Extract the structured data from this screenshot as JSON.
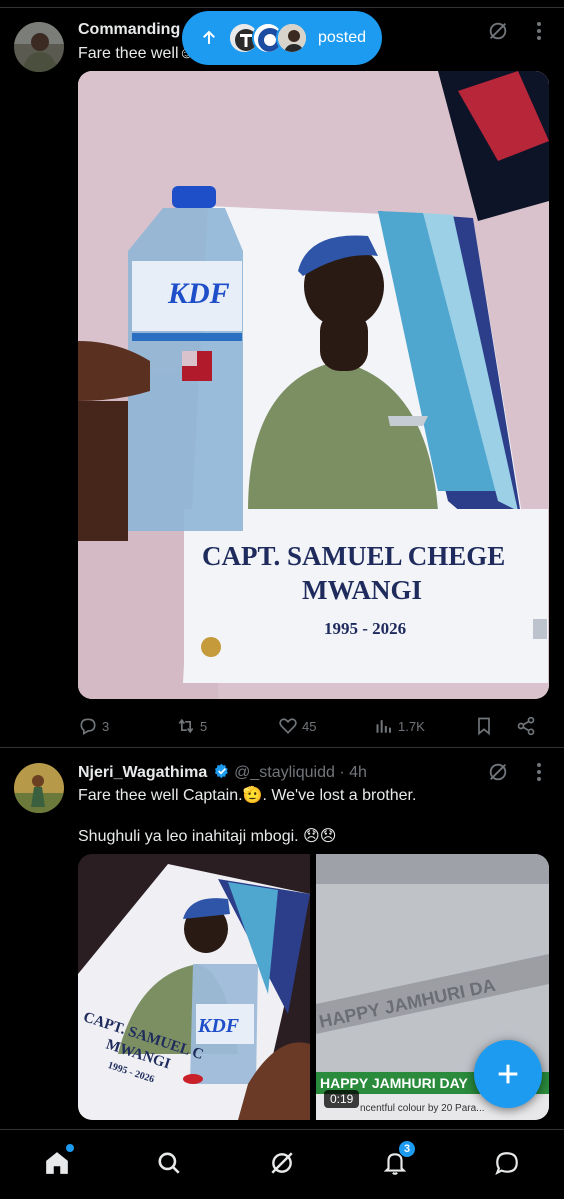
{
  "tweet1": {
    "display_name": "Commanding",
    "text": "Fare thee well☺",
    "image_poster_name_line1": "CAPT. SAMUEL CHEGE",
    "image_poster_name_line2": "MWANGI",
    "image_poster_years": "1995 - 2026",
    "image_bottle_brand": "KDF",
    "stats": {
      "replies": "3",
      "reposts": "5",
      "likes": "45",
      "views": "1.7K"
    }
  },
  "new_posts_pill": {
    "label": "posted"
  },
  "tweet2": {
    "display_name": "Njeri_Wagathima",
    "handle": "@_stayliquidd",
    "time": "· 4h",
    "line1": "Fare thee well Captain.🫡. We've lost a brother.",
    "line2": "Shughuli ya leo inahitaji mbogi. 😞😞",
    "media_left_text1": "CAPT. SAMUEL C",
    "media_left_text2": "MWANGI",
    "media_left_years": "1995 - 2026",
    "media_left_brand": "KDF",
    "media_right_banner": "HAPPY JAMHURI DAY",
    "media_right_sign": "HAPPY JAMHURI DA",
    "media_right_ticker": "ncentful colour by 20 Para...",
    "video_duration": "0:19"
  },
  "bottom_nav": {
    "notifications_count": "3"
  },
  "colors": {
    "accent": "#1d9bf0",
    "muted": "#71767b",
    "verified": "#1d9bf0",
    "divider": "#2f3336"
  }
}
